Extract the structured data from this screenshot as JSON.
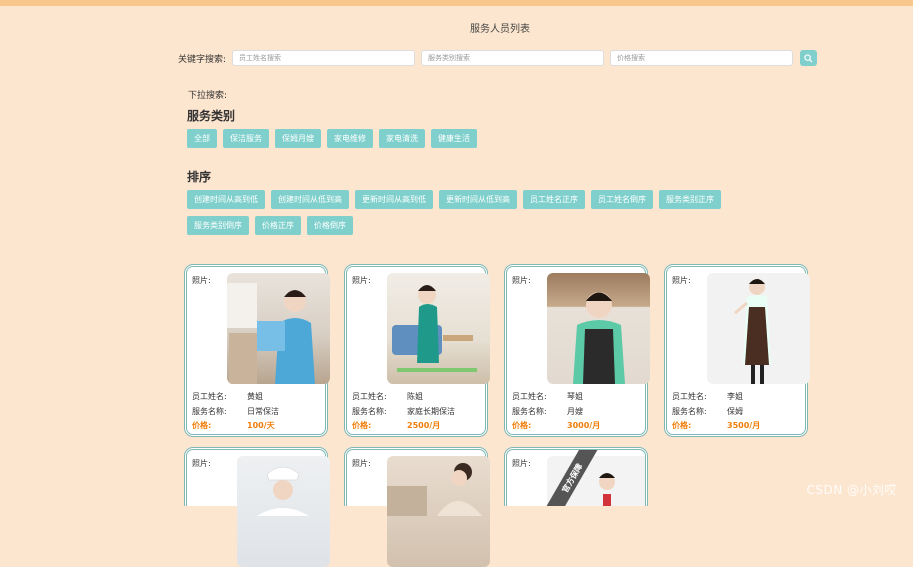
{
  "page_title": "服务人员列表",
  "search": {
    "label": "关键字搜索:",
    "name_placeholder": "员工姓名搜索",
    "type_placeholder": "服务类别搜索",
    "price_placeholder": "价格搜索",
    "button_icon": "search-icon"
  },
  "dropdown_label": "下拉搜索:",
  "categories": {
    "title": "服务类别",
    "items": [
      "全部",
      "保洁服务",
      "保姆月嫂",
      "家电维修",
      "家电清洗",
      "健康生活"
    ]
  },
  "sort": {
    "title": "排序",
    "row1": [
      "创建时间从高到低",
      "创建时间从低到高",
      "更新时间从高到低",
      "更新时间从低到高",
      "员工姓名正序",
      "员工姓名倒序",
      "服务类别正序"
    ],
    "row2": [
      "服务类别倒序",
      "价格正序",
      "价格倒序"
    ]
  },
  "labels": {
    "photo": "照片:",
    "name": "员工姓名:",
    "service": "服务名称:",
    "price": "价格:"
  },
  "cards": [
    {
      "name": "黄姐",
      "service": "日常保洁",
      "price": "100/天"
    },
    {
      "name": "陈姐",
      "service": "家庭长期保洁",
      "price": "2500/月"
    },
    {
      "name": "琴姐",
      "service": "月嫂",
      "price": "3000/月"
    },
    {
      "name": "李姐",
      "service": "保姆",
      "price": "3500/月"
    },
    {
      "name": "",
      "service": "",
      "price": ""
    },
    {
      "name": "",
      "service": "",
      "price": ""
    },
    {
      "name": "",
      "service": "",
      "price": ""
    }
  ],
  "badge_text": "官方保障",
  "watermark": "CSDN @小刘哎",
  "colors": {
    "background": "#fde6cf",
    "top_bar": "#f9c78b",
    "accent": "#7fd0cc",
    "card_border": "#7fb8b4",
    "price": "#ef7e0a"
  }
}
